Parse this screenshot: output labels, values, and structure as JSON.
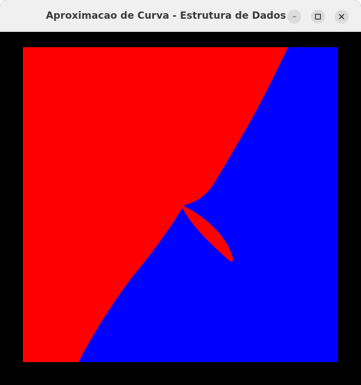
{
  "window": {
    "title": "Aproximacao de Curva - Estrutura de Dados",
    "controls": {
      "minimize_icon": "minimize-icon",
      "maximize_icon": "maximize-icon",
      "close_icon": "close-icon"
    }
  },
  "canvas": {
    "background_color": "#000000",
    "region_colors": {
      "left_region": "#ff0000",
      "right_region": "#0000ff"
    }
  }
}
